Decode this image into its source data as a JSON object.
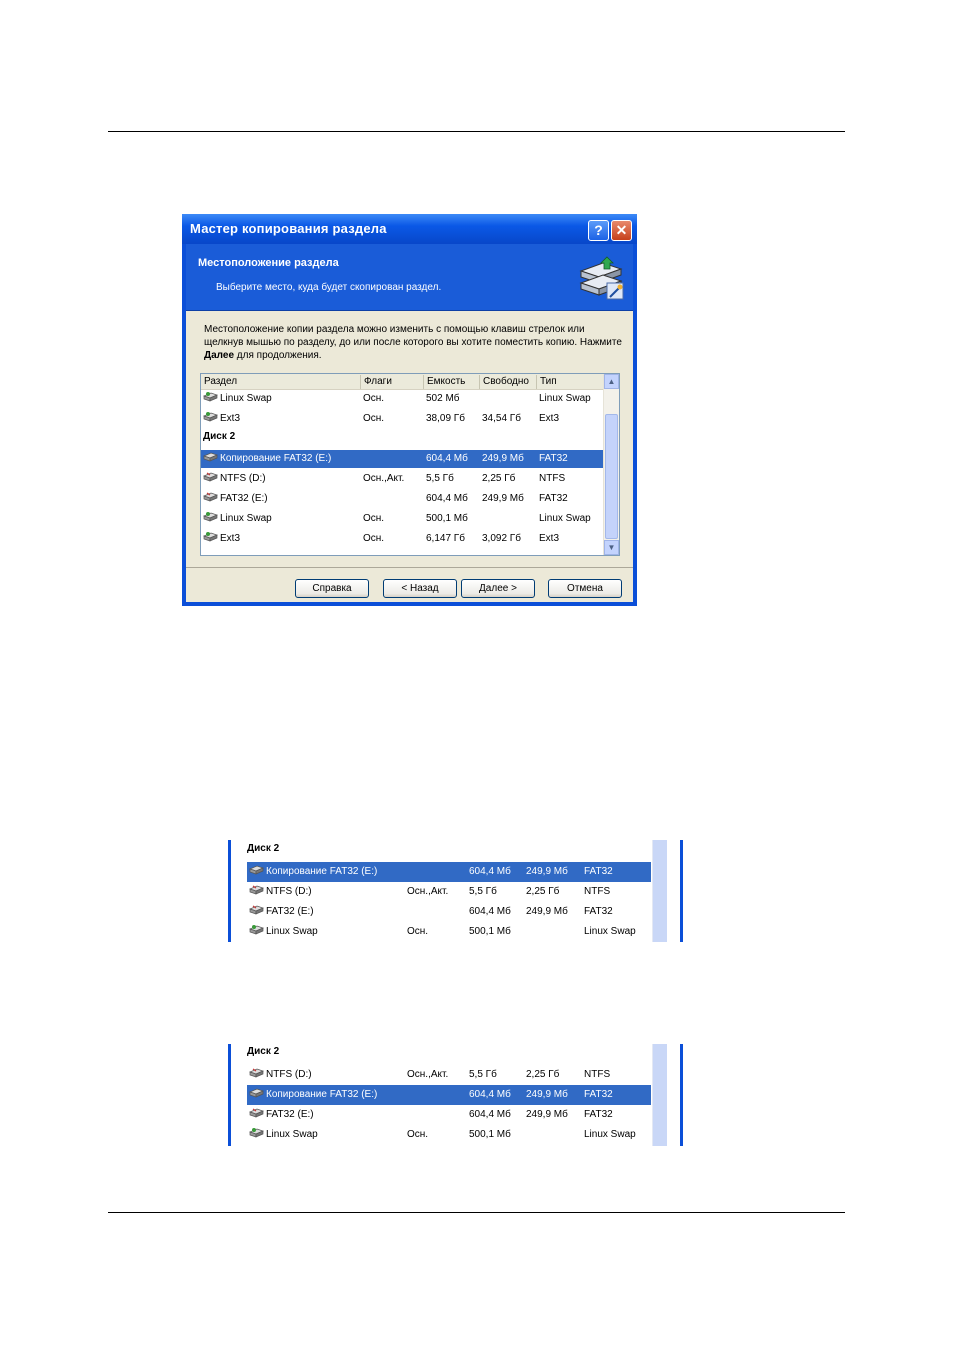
{
  "dialog": {
    "title": "Мастер копирования раздела",
    "help_label": "?",
    "close_label": "✕",
    "header_title": "Местоположение раздела",
    "header_subtitle": "Выберите место, куда будет скопирован раздел.",
    "description_part1": "Местоположение копии раздела можно изменить с помощью клавиш стрелок или щелкнув мышью по разделу, до или после которого вы хотите поместить копию. Нажмите ",
    "description_bold": "Далее",
    "description_part2": " для продолжения.",
    "columns": [
      "Раздел",
      "Флаги",
      "Емкость",
      "Свободно",
      "Тип"
    ],
    "rows": [
      {
        "name": "Linux Swap",
        "flags": "Осн.",
        "capacity": "502 Мб",
        "free": "",
        "type": "Linux Swap"
      },
      {
        "name": "Ext3",
        "flags": "Осн.",
        "capacity": "38,09 Гб",
        "free": "34,54 Гб",
        "type": "Ext3"
      }
    ],
    "disk_label": "Диск 2",
    "disk2_rows": [
      {
        "name": "Копирование FAT32 (E:)",
        "flags": "",
        "capacity": "604,4 Мб",
        "free": "249,9 Мб",
        "type": "FAT32"
      },
      {
        "name": "NTFS (D:)",
        "flags": "Осн.,Акт.",
        "capacity": "5,5 Гб",
        "free": "2,25 Гб",
        "type": "NTFS"
      },
      {
        "name": "FAT32 (E:)",
        "flags": "",
        "capacity": "604,4 Мб",
        "free": "249,9 Мб",
        "type": "FAT32"
      },
      {
        "name": "Linux Swap",
        "flags": "Осн.",
        "capacity": "500,1 Мб",
        "free": "",
        "type": "Linux Swap"
      },
      {
        "name": "Ext3",
        "flags": "Осн.",
        "capacity": "6,147 Гб",
        "free": "3,092 Гб",
        "type": "Ext3"
      }
    ],
    "buttons": {
      "help": "Справка",
      "back": "< Назад",
      "next": "Далее >",
      "cancel": "Отмена"
    }
  },
  "snippet1": {
    "disk_label": "Диск 2",
    "rows": [
      {
        "name": "Копирование FAT32 (E:)",
        "flags": "",
        "capacity": "604,4 Мб",
        "free": "249,9 Мб",
        "type": "FAT32"
      },
      {
        "name": "NTFS (D:)",
        "flags": "Осн.,Акт.",
        "capacity": "5,5 Гб",
        "free": "2,25 Гб",
        "type": "NTFS"
      },
      {
        "name": "FAT32 (E:)",
        "flags": "",
        "capacity": "604,4 Мб",
        "free": "249,9 Мб",
        "type": "FAT32"
      },
      {
        "name": "Linux Swap",
        "flags": "Осн.",
        "capacity": "500,1 Мб",
        "free": "",
        "type": "Linux Swap"
      }
    ]
  },
  "snippet2": {
    "disk_label": "Диск 2",
    "rows": [
      {
        "name": "NTFS (D:)",
        "flags": "Осн.,Акт.",
        "capacity": "5,5 Гб",
        "free": "2,25 Гб",
        "type": "NTFS"
      },
      {
        "name": "Копирование FAT32 (E:)",
        "flags": "",
        "capacity": "604,4 Мб",
        "free": "249,9 Мб",
        "type": "FAT32"
      },
      {
        "name": "FAT32 (E:)",
        "flags": "",
        "capacity": "604,4 Мб",
        "free": "249,9 Мб",
        "type": "FAT32"
      },
      {
        "name": "Linux Swap",
        "flags": "Осн.",
        "capacity": "500,1 Мб",
        "free": "",
        "type": "Linux Swap"
      }
    ]
  },
  "colors": {
    "selection": "#316ac5",
    "title_bar": "#0a58e6"
  }
}
